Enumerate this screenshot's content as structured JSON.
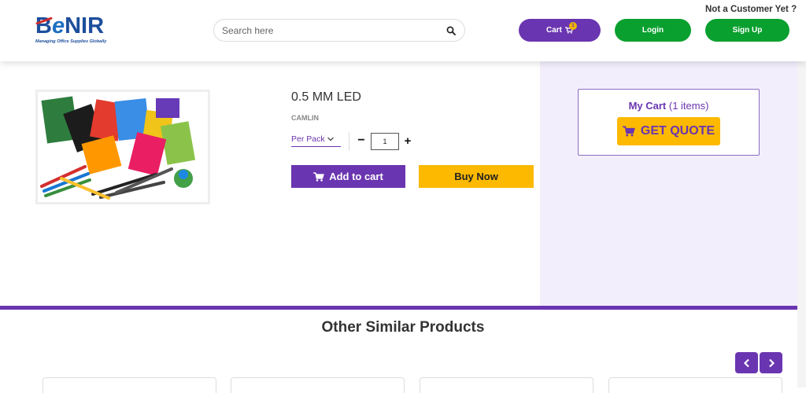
{
  "header": {
    "logo_text_b": "B",
    "logo_text_e": "e",
    "logo_text_rest": "NIR",
    "logo_tagline": "Managing Office Supplies Globally",
    "search_placeholder": "Search here",
    "not_customer_text": "Not a Customer Yet ?",
    "cart_label": "Cart",
    "cart_count": "1",
    "login_label": "Login",
    "signup_label": "Sign Up"
  },
  "product": {
    "image_icon": "stationery-product-image",
    "title": "0.5 MM LED",
    "brand": "CAMLIN",
    "unit": "Per Pack",
    "quantity": "1",
    "minus_label": "−",
    "plus_label": "+",
    "add_to_cart_label": "Add to cart",
    "buy_now_label": "Buy Now"
  },
  "my_cart": {
    "title": "My Cart",
    "items": "(1 items)",
    "get_quote_label": "GET QUOTE"
  },
  "similar": {
    "title": "Other Similar Products"
  },
  "colors": {
    "purple": "#6a35b0",
    "green": "#0aa02f",
    "yellow": "#fcb900",
    "panel_bg": "#f3eefc"
  }
}
